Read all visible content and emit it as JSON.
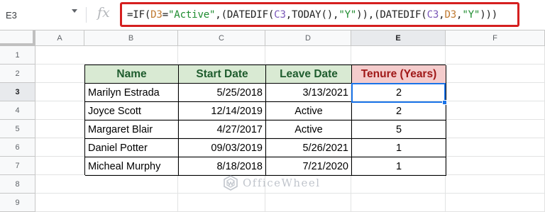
{
  "formula_bar": {
    "name_box": "E3",
    "fx_label": "fx",
    "formula_tokens": [
      {
        "text": "=IF(",
        "kind": "plain"
      },
      {
        "text": "D3",
        "kind": "ref-d"
      },
      {
        "text": "=",
        "kind": "plain"
      },
      {
        "text": "\"Active\"",
        "kind": "str"
      },
      {
        "text": ",(DATEDIF(",
        "kind": "plain"
      },
      {
        "text": "C3",
        "kind": "ref-c"
      },
      {
        "text": ",TODAY(),",
        "kind": "plain"
      },
      {
        "text": "\"Y\"",
        "kind": "str"
      },
      {
        "text": ")),(DATEDIF(",
        "kind": "plain"
      },
      {
        "text": "C3",
        "kind": "ref-c"
      },
      {
        "text": ",",
        "kind": "plain"
      },
      {
        "text": "D3",
        "kind": "ref-d"
      },
      {
        "text": ",",
        "kind": "plain"
      },
      {
        "text": "\"Y\"",
        "kind": "str"
      },
      {
        "text": ")))",
        "kind": "plain"
      }
    ]
  },
  "columns": [
    "A",
    "B",
    "C",
    "D",
    "E",
    "F"
  ],
  "rows": [
    "1",
    "2",
    "3",
    "4",
    "5",
    "6",
    "7",
    "8",
    "9"
  ],
  "selected": {
    "column": "E",
    "row": "3"
  },
  "table": {
    "headers": [
      "Name",
      "Start Date",
      "Leave Date",
      "Tenure (Years)"
    ],
    "rows": [
      [
        "Marilyn Estrada",
        "5/25/2018",
        "3/13/2021",
        "2"
      ],
      [
        "Joyce Scott",
        "12/14/2019",
        "Active",
        "2"
      ],
      [
        "Margaret Blair",
        "4/27/2017",
        "Active",
        "5"
      ],
      [
        "Daniel Potter",
        "09/03/2019",
        "5/26/2021",
        "1"
      ],
      [
        "Micheal Murphy",
        "8/18/2018",
        "7/21/2020",
        "1"
      ]
    ]
  },
  "watermark": "OfficeWheel",
  "colors": {
    "header_green": "#d9ead3",
    "header_red": "#f4cccc",
    "formula_outline": "#d51f1f",
    "selection": "#1a73e8"
  }
}
